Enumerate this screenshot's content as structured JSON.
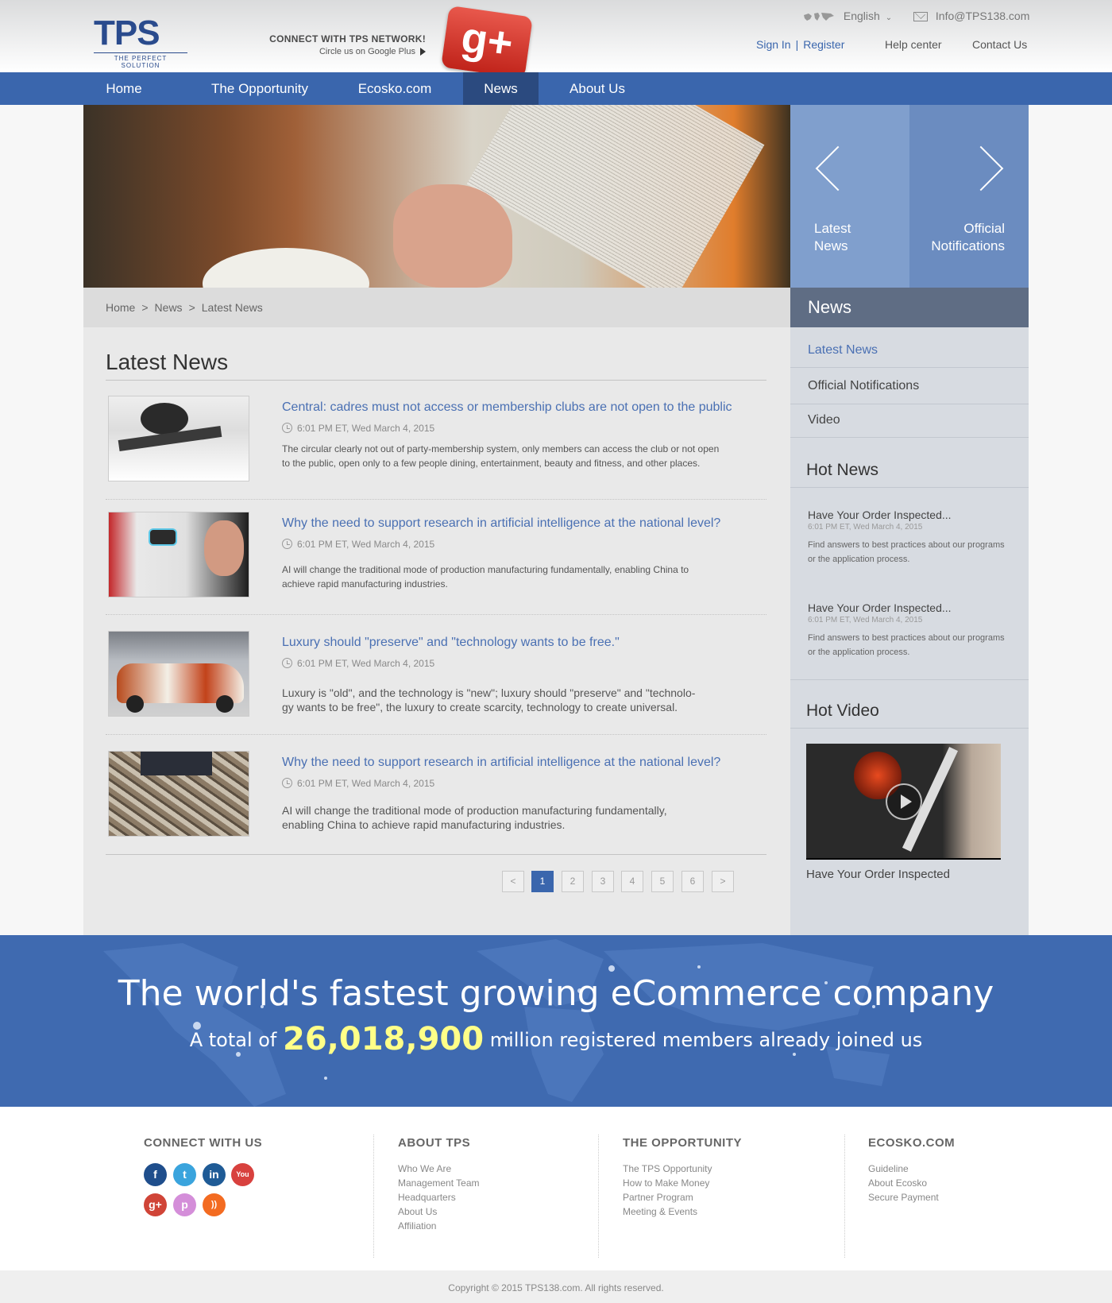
{
  "header": {
    "logo_text": "TPS",
    "logo_tagline": "THE PERFECT SOLUTION",
    "connect_line1": "CONNECT WITH TPS NETWORK!",
    "connect_line2": "Circle us on Google Plus",
    "gplus_label": "g+",
    "language": "English",
    "email": "Info@TPS138.com",
    "sign_in": "Sign In",
    "separator": "|",
    "register": "Register",
    "help_center": "Help center",
    "contact_us": "Contact Us"
  },
  "nav": {
    "items": [
      {
        "label": "Home"
      },
      {
        "label": "The Opportunity"
      },
      {
        "label": "Ecosko.com"
      },
      {
        "label": "News"
      },
      {
        "label": "About Us"
      }
    ],
    "active": "News"
  },
  "slider": {
    "left_line1": "Latest",
    "left_line2": "News",
    "right_line1": "Official",
    "right_line2": "Notifications"
  },
  "breadcrumb": {
    "items": [
      "Home",
      "News",
      "Latest News"
    ],
    "separator": ">"
  },
  "main": {
    "title": "Latest News",
    "news": [
      {
        "title": "Central: cadres must not access or membership clubs are not open to the public",
        "time": "6:01 PM ET, Wed March 4, 2015",
        "desc_line1": "The circular clearly not out of party-membership system, only members can access the club or not open",
        "desc_line2": "to the public, open only to a few people dining, entertainment, beauty and fitness, and other places."
      },
      {
        "title": "Why the need to support research in artificial intelligence at the national level?",
        "time": "6:01 PM ET, Wed March 4, 2015",
        "desc_line1": "AI will change the traditional mode of production manufacturing fundamentally, enabling China to",
        "desc_line2": "achieve rapid manufacturing industries."
      },
      {
        "title": "Luxury should \"preserve\" and \"technology wants to be free.\"",
        "time": "6:01 PM ET, Wed March 4, 2015",
        "desc_line1": "Luxury is \"old\", and the technology is \"new\"; luxury should \"preserve\" and \"technolo-",
        "desc_line2": "gy wants to be free\", the luxury to create scarcity, technology to create universal."
      },
      {
        "title": "Why the need to support research in artificial intelligence at the national level?",
        "time": "6:01 PM ET, Wed March 4, 2015",
        "desc_line1": "AI will change the traditional mode of production manufacturing fundamentally,",
        "desc_line2": "enabling China to achieve rapid manufacturing industries."
      }
    ],
    "pager": {
      "prev": "<",
      "pages": [
        "1",
        "2",
        "3",
        "4",
        "5",
        "6"
      ],
      "current": "1",
      "next": ">"
    }
  },
  "sidebar": {
    "heading": "News",
    "menu": [
      "Latest News",
      "Official Notifications",
      "Video"
    ],
    "menu_active": "Latest News",
    "hot_news_title": "Hot News",
    "hot_news": [
      {
        "title": "Have Your Order Inspected...",
        "time": "6:01 PM ET, Wed March 4, 2015",
        "desc_line1": "Find answers to best practices about our programs",
        "desc_line2": "or the application process."
      },
      {
        "title": "Have Your Order Inspected...",
        "time": "6:01 PM ET, Wed March 4, 2015",
        "desc_line1": "Find answers to best practices about our programs",
        "desc_line2": "or the application process."
      }
    ],
    "hot_video_title": "Hot Video",
    "video_caption": "Have Your Order Inspected"
  },
  "banner": {
    "headline": "The world's fastest growing eCommerce company",
    "prefix": "A total of",
    "number": "26,018,900",
    "suffix": "million registered members already joined us"
  },
  "footer": {
    "connect_title": "CONNECT WITH US",
    "social": [
      {
        "icon": "facebook-icon",
        "glyph": "f",
        "color": "#1f4e8c"
      },
      {
        "icon": "twitter-icon",
        "glyph": "t",
        "color": "#3aa4dd"
      },
      {
        "icon": "linkedin-icon",
        "glyph": "in",
        "color": "#1f5b96"
      },
      {
        "icon": "youtube-icon",
        "glyph": "You",
        "color": "#d8413e"
      },
      {
        "icon": "googleplus-icon",
        "glyph": "g+",
        "color": "#d04437"
      },
      {
        "icon": "pinterest-icon",
        "glyph": "p",
        "color": "#d48ed9"
      },
      {
        "icon": "rss-icon",
        "glyph": "))",
        "color": "#f36b21"
      }
    ],
    "about_title": "ABOUT TPS",
    "about_links": [
      "Who We Are",
      "Management Team",
      "Headquarters",
      "About Us",
      "Affiliation"
    ],
    "opportunity_title": "THE OPPORTUNITY",
    "opportunity_links": [
      "The TPS Opportunity",
      "How to Make Money",
      "Partner Program",
      "Meeting & Events"
    ],
    "ecosko_title": "ECOSKO.COM",
    "ecosko_links": [
      "Guideline",
      "About Ecosko",
      "Secure Payment"
    ],
    "copyright": "Copyright © 2015 TPS138.com.  All rights reserved."
  },
  "colors": {
    "brand_blue": "#3a66ad",
    "nav_active": "#2b4a7f",
    "link_blue": "#4a70b3",
    "logo_red": "#d9312a",
    "number_yellow": "#ffff88"
  }
}
